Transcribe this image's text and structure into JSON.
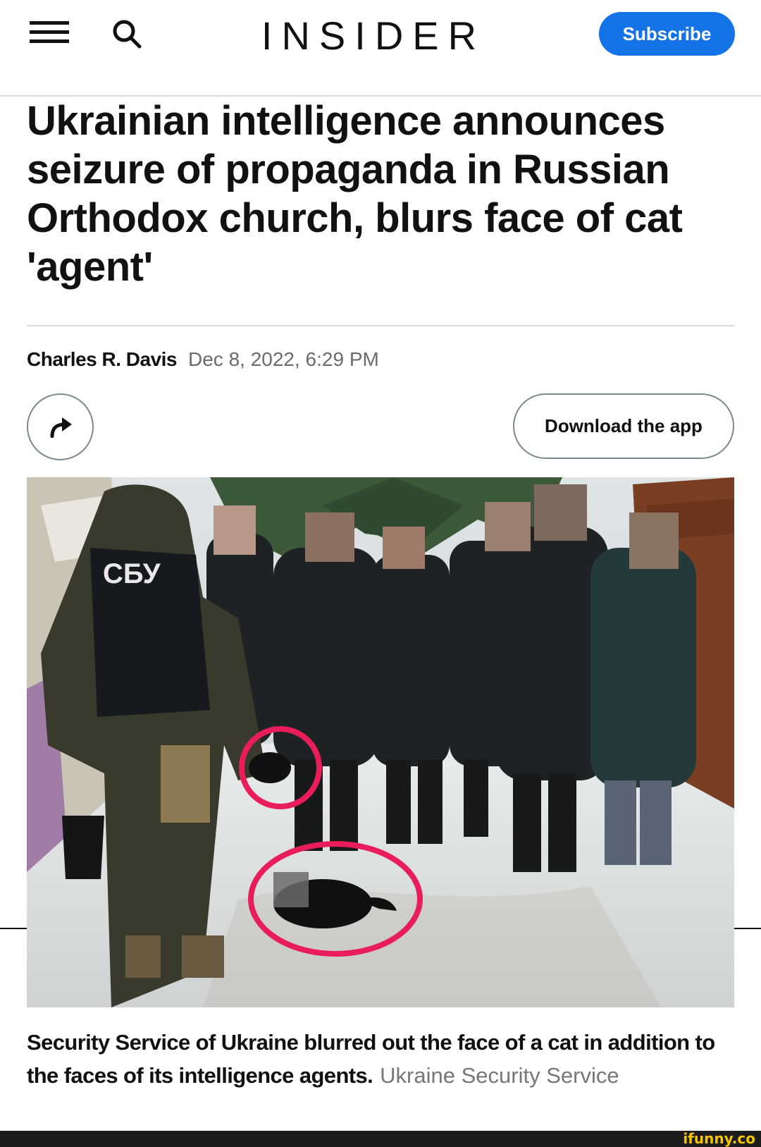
{
  "header": {
    "menu_icon": "hamburger-menu-icon",
    "search_icon": "search-icon",
    "logo": "INSIDER",
    "subscribe_label": "Subscribe",
    "accent_color": "#1473e6"
  },
  "article": {
    "headline": "Ukrainian intelligence announces seizure of propaganda in Russian Orthodox church, blurs face of cat 'agent'",
    "author": "Charles R. Davis",
    "date": "Dec 8, 2022, 6:29 PM",
    "share_icon": "share-arrow-icon",
    "download_label": "Download the app",
    "image": {
      "vest_label": "СБУ"
    },
    "caption": "Security Service of Ukraine blurred out the face of a cat in addition to the faces of its intelligence agents.",
    "credit": "Ukraine Security Service"
  },
  "footer": {
    "watermark": "ifunny.co",
    "watermark_color": "#f5c400"
  }
}
